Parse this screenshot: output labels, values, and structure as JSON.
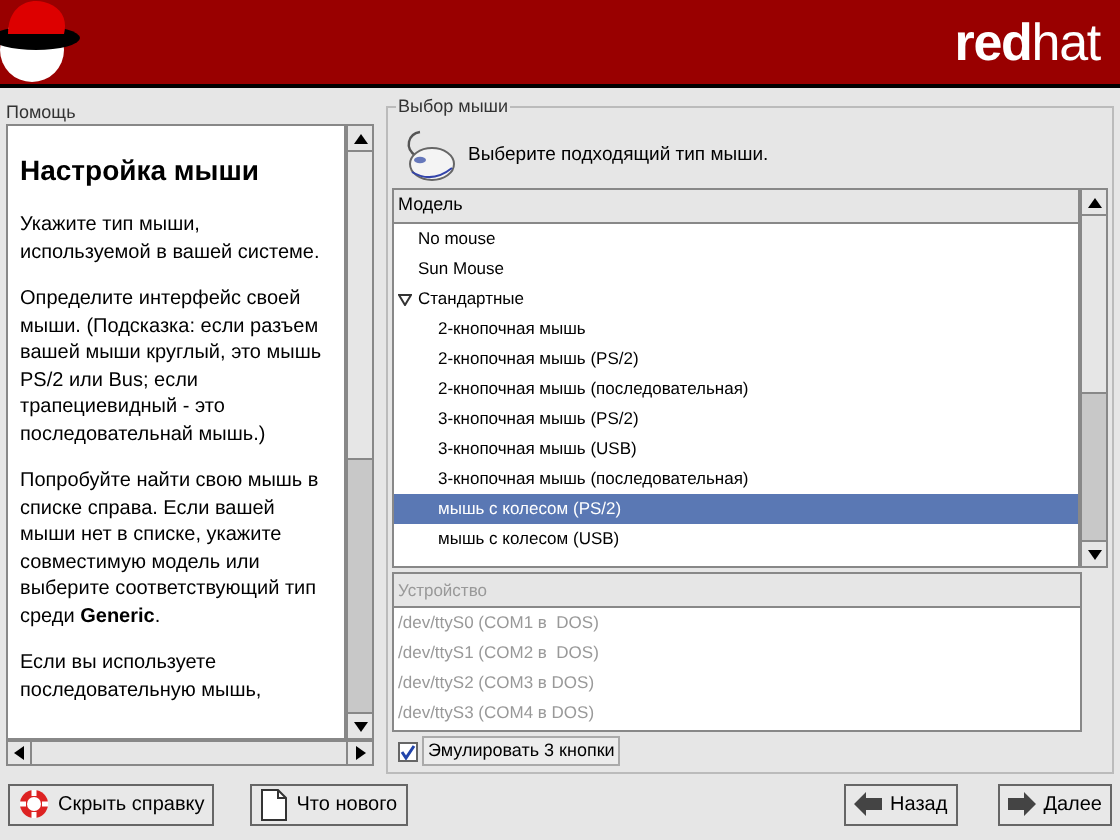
{
  "header": {
    "logo_text": "**red**hat"
  },
  "help": {
    "title": "Помощь",
    "heading": "Настройка мыши",
    "paragraphs": [
      "Укажите тип мыши, используемой в вашей системе.",
      "Определите интерфейс своей мыши. (Подсказка: если разъем вашей мыши круглый, это мышь PS/2 или Bus; если трапециевидный - это последовательнай мышь.)",
      "Попробуйте найти свою мышь в списке справа. Если вашей мыши нет в списке, укажите совместимую модель или выберите соответствующий тип среди **Generic**.",
      "Если вы используете последовательную мышь,"
    ]
  },
  "mouse_panel": {
    "title": "Выбор мыши",
    "prompt": "Выберите подходящий тип мыши.",
    "model_list": {
      "column": "Модель",
      "items": [
        {
          "label": "No mouse",
          "selected": false
        },
        {
          "label": "Sun Mouse",
          "selected": false
        },
        {
          "label": "Стандартные",
          "selected": false,
          "expanded": true,
          "children": [
            {
              "label": "2-кнопочная мышь",
              "selected": false
            },
            {
              "label": "2-кнопочная мышь (PS/2)",
              "selected": false
            },
            {
              "label": "2-кнопочная мышь (последовательная)",
              "selected": false
            },
            {
              "label": "3-кнопочная мышь (PS/2)",
              "selected": false
            },
            {
              "label": "3-кнопочная мышь (USB)",
              "selected": false
            },
            {
              "label": "3-кнопочная мышь (последовательная)",
              "selected": false
            },
            {
              "label": "мышь с колесом (PS/2)",
              "selected": true
            },
            {
              "label": "мышь с колесом (USB)",
              "selected": false
            }
          ]
        }
      ]
    },
    "device_list": {
      "column": "Устройство",
      "disabled": true,
      "items": [
        "/dev/ttyS0 (COM1 в  DOS)",
        "/dev/ttyS1 (COM2 в  DOS)",
        "/dev/ttyS2 (COM3 в DOS)",
        "/dev/ttyS3 (COM4 в DOS)"
      ]
    },
    "emulate": {
      "label": "Эмулировать 3 кнопки",
      "checked": true
    }
  },
  "buttons": [
    {
      "kind": "help",
      "label": "Скрыть справку"
    },
    {
      "kind": "notes",
      "label": "Что нового"
    },
    {
      "kind": "back",
      "label": "Назад"
    },
    {
      "kind": "next",
      "label": "Далее"
    }
  ]
}
